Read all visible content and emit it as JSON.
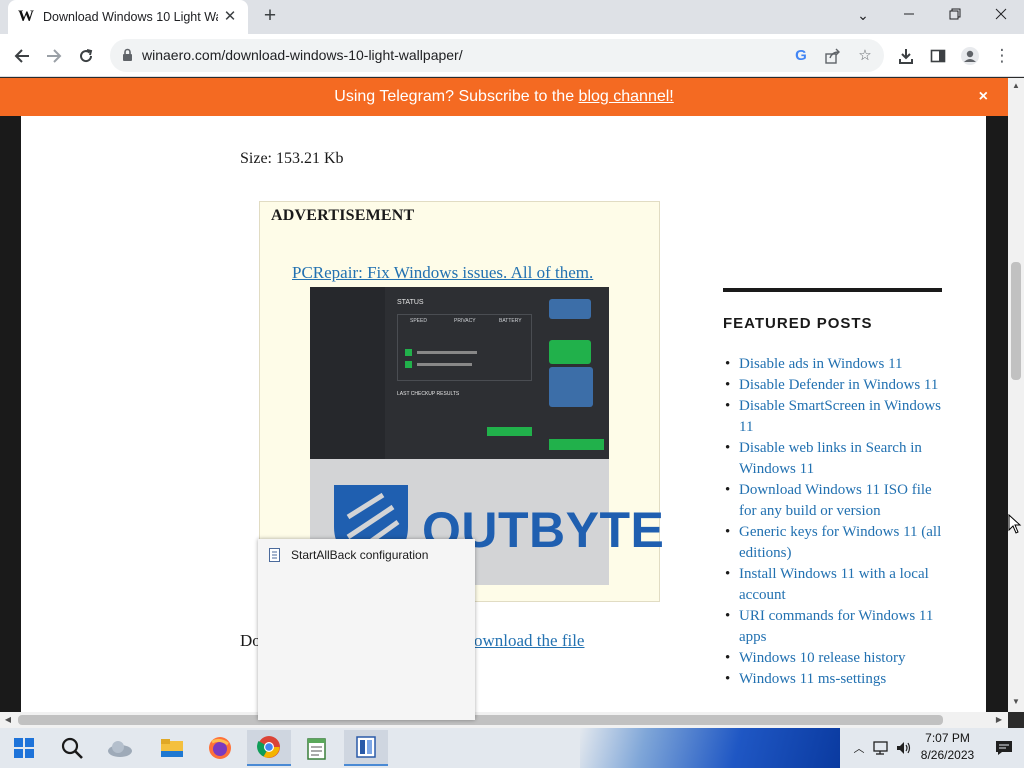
{
  "browser": {
    "tab_title": "Download Windows 10 Light Wa",
    "favicon_letter": "W",
    "url": "winaero.com/download-windows-10-light-wallpaper/"
  },
  "banner": {
    "text_before": "Using Telegram? Subscribe to the ",
    "link_text": "blog channel!",
    "close": "×"
  },
  "article": {
    "size_text": "Size: 153.21 Kb",
    "ad_label": "ADVERTISEMENT",
    "ad_link": "PCRepair: Fix Windows issues. All of them.",
    "download_prefix": "Do",
    "download_link": "ownload the file"
  },
  "ad_image": {
    "status": "STATUS",
    "tabs": [
      "SPEED",
      "PRIVACY",
      "BATTERY"
    ],
    "last_checkup": "LAST CHECKUP RESULTS",
    "brand": "OUTBYTE",
    "brand_color": "#1f5fb0",
    "accent_green": "#21b14b"
  },
  "sidebar": {
    "featured_title": "FEATURED POSTS",
    "posts": [
      "Disable ads in Windows 11",
      "Disable Defender in Windows 11",
      "Disable SmartScreen in Windows 11",
      "Disable web links in Search in Windows 11",
      "Download Windows 11 ISO file for any build or version",
      "Generic keys for Windows 11 (all editions)",
      "Install Windows 11 with a local account",
      "URI commands for Windows 11 apps",
      "Windows 10 release history",
      "Windows 11 ms-settings"
    ]
  },
  "popup": {
    "item": "StartAllBack configuration"
  },
  "taskbar": {
    "time": "7:07 PM",
    "date": "8/26/2023"
  },
  "colors": {
    "banner": "#f46a22",
    "link": "#2271b1"
  }
}
